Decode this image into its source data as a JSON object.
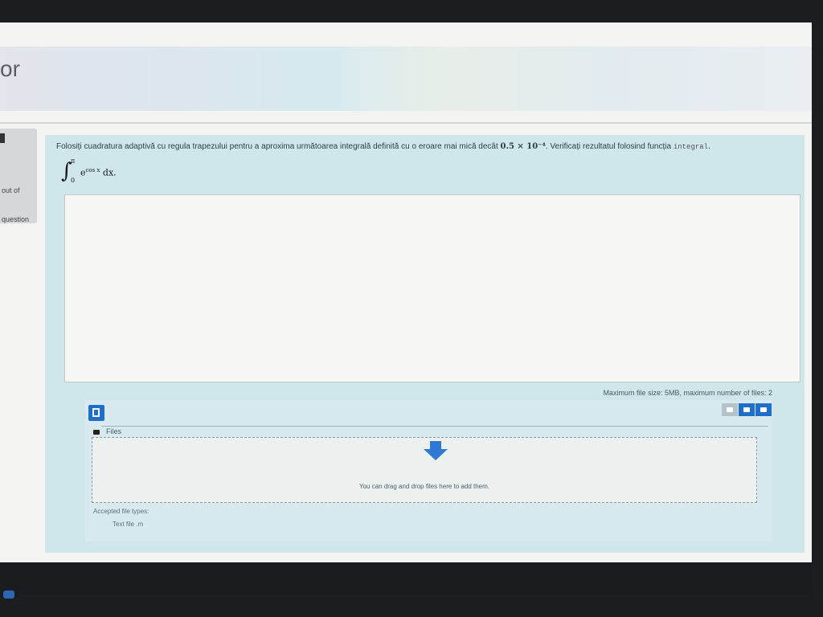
{
  "header": {
    "title": "or"
  },
  "info": {
    "mark_text": "out of",
    "flag_text": "question"
  },
  "question": {
    "text_prefix": "Folosiți cuadratura adaptivă cu regula trapezului pentru a aproxima următoarea integrală definită cu o eroare mai mică decât",
    "error_value": "0.5 × 10⁻⁴",
    "text_middle": ". Verificați rezultatul folosind funcția",
    "function_name": "integral",
    "text_suffix": ".",
    "formula": {
      "upper": "π",
      "lower": "0",
      "integrand_base": "e",
      "integrand_exp": "cos x",
      "differential": " dx."
    }
  },
  "files": {
    "limits": "Maximum file size: 5MB, maximum number of files: 2",
    "folder_label": "Files",
    "drop_text": "You can drag and drop files here to add them.",
    "accepted_title": "Accepted file types:",
    "accepted_item": "Text file .m"
  }
}
